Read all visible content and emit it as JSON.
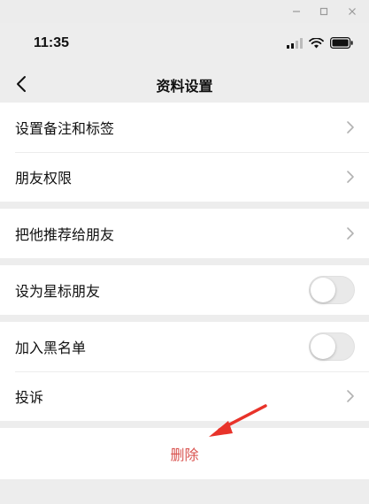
{
  "status_bar": {
    "time": "11:35"
  },
  "nav": {
    "title": "资料设置"
  },
  "groups": [
    {
      "items": [
        {
          "label": "设置备注和标签",
          "control": "chevron"
        },
        {
          "label": "朋友权限",
          "control": "chevron"
        }
      ]
    },
    {
      "items": [
        {
          "label": "把他推荐给朋友",
          "control": "chevron"
        }
      ]
    },
    {
      "items": [
        {
          "label": "设为星标朋友",
          "control": "toggle",
          "on": false
        }
      ]
    },
    {
      "items": [
        {
          "label": "加入黑名单",
          "control": "toggle",
          "on": false
        },
        {
          "label": "投诉",
          "control": "chevron"
        }
      ]
    }
  ],
  "delete": {
    "label": "删除"
  },
  "colors": {
    "delete_text": "#d9534f",
    "annotation_arrow": "#e8332a",
    "background": "#ededed"
  },
  "icons": [
    "window-minimize-icon",
    "window-maximize-icon",
    "window-close-icon",
    "signal-icon",
    "wifi-icon",
    "battery-icon",
    "back-chevron-icon",
    "chevron-right-icon"
  ]
}
